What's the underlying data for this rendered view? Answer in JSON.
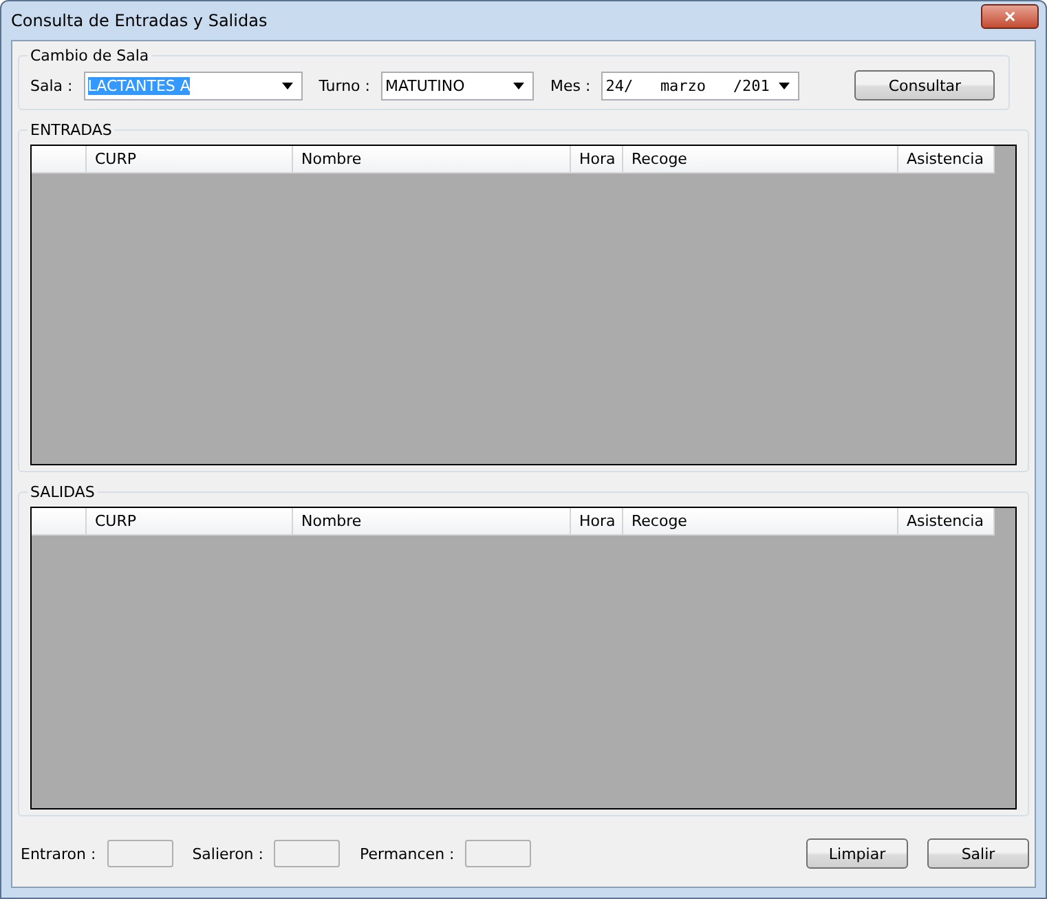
{
  "window": {
    "title": "Consulta de Entradas y Salidas",
    "close": "✕"
  },
  "filter_group": {
    "title": "Cambio de Sala",
    "fields": [
      {
        "label": "Sala :",
        "value": "LACTANTES A",
        "selected": true
      },
      {
        "label": "Turno :",
        "value": "MATUTINO",
        "selected": false
      },
      {
        "label": "Mes :",
        "value": "24/   marzo   /201",
        "selected": false
      }
    ],
    "button": "Consultar"
  },
  "grids": [
    {
      "title": "ENTRADAS",
      "columns": [
        "CURP",
        "Nombre",
        "Hora",
        "Recoge",
        "Asistencia"
      ]
    },
    {
      "title": "SALIDAS",
      "columns": [
        "CURP",
        "Nombre",
        "Hora",
        "Recoge",
        "Asistencia"
      ]
    }
  ],
  "counters": [
    {
      "label": "Entraron :"
    },
    {
      "label": "Salieron :"
    },
    {
      "label": "Permancen :"
    }
  ],
  "buttons": [
    "Limpiar",
    "Salir"
  ]
}
